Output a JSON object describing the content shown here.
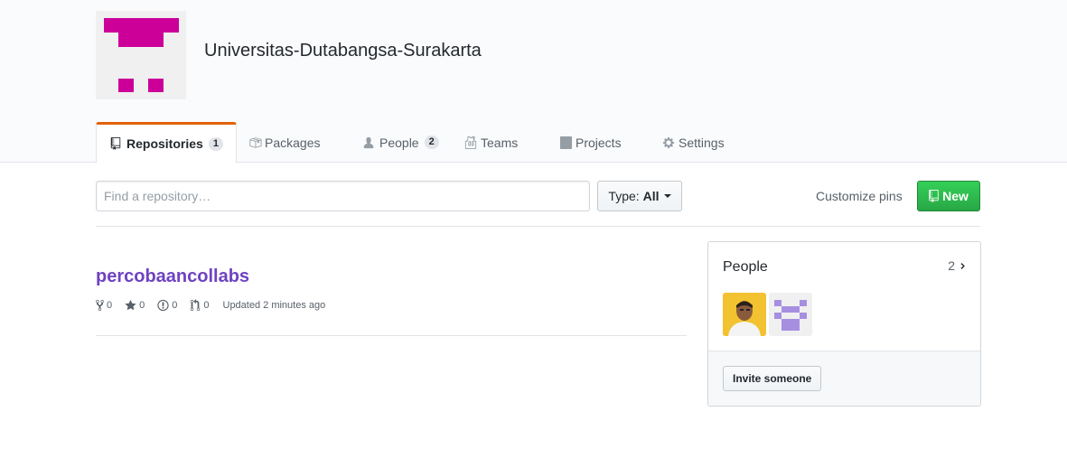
{
  "org": {
    "name": "Universitas-Dutabangsa-Surakarta",
    "avatar_color": "#cc0099"
  },
  "tabs": [
    {
      "label": "Repositories",
      "count": "1",
      "icon": "repo-icon"
    },
    {
      "label": "Packages",
      "icon": "package-icon"
    },
    {
      "label": "People",
      "count": "2",
      "icon": "person-icon"
    },
    {
      "label": "Teams",
      "icon": "jersey-icon"
    },
    {
      "label": "Projects",
      "icon": "project-icon"
    },
    {
      "label": "Settings",
      "icon": "gear-icon"
    }
  ],
  "toolbar": {
    "search_placeholder": "Find a repository…",
    "type_label": "Type:",
    "type_value": "All",
    "customize_label": "Customize pins",
    "new_label": "New"
  },
  "repo": {
    "name": "percobaancollabs",
    "forks": "0",
    "stars": "0",
    "issues": "0",
    "pulls": "0",
    "updated": "Updated 2 minutes ago"
  },
  "people": {
    "title": "People",
    "count": "2",
    "invite_label": "Invite someone"
  },
  "colors": {
    "accent_tab": "#e36209",
    "repo_link": "#6f42c1",
    "new_button": "#28a745"
  }
}
